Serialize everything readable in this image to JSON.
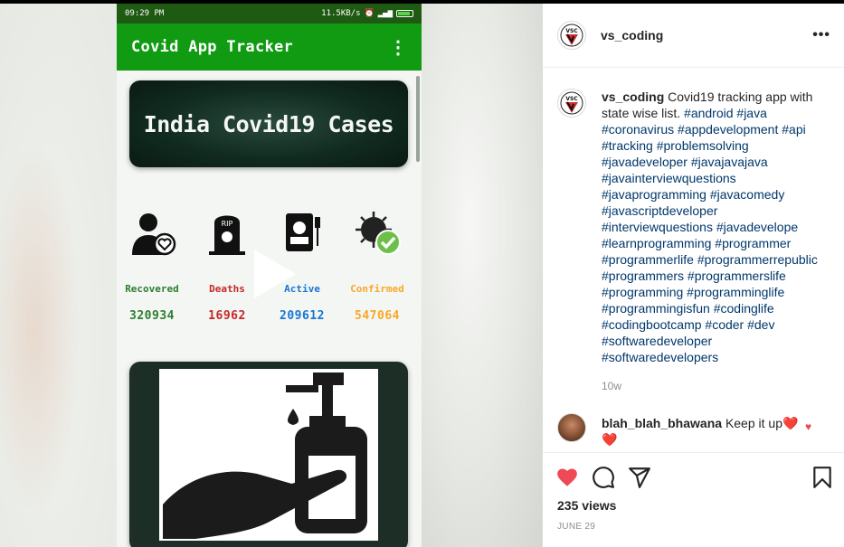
{
  "phone": {
    "status_time": "09:29 PM",
    "status_speed": "11.5KB/s",
    "app_title": "Covid App Tracker",
    "banner_title": "India Covid19 Cases",
    "stats": [
      {
        "label": "Recovered",
        "value": "320934",
        "color": "#2e7d32"
      },
      {
        "label": "Deaths",
        "value": "16962",
        "color": "#c62828"
      },
      {
        "label": "Active",
        "value": "209612",
        "color": "#1976d2"
      },
      {
        "label": "Confirmed",
        "value": "547064",
        "color": "#f9a825"
      }
    ],
    "banner_rip": "RIP"
  },
  "post": {
    "username": "vs_coding",
    "avatar_text": "VSC",
    "caption_text": "Covid19 tracking app with state wise list.",
    "hashtags": "#android #java #coronavirus #appdevelopment #api #tracking #problemsolving #javadeveloper #javajavajava #javainterviewquestions #javaprogramming #javacomedy #javascriptdeveloper #interviewquestions #javadevelope #learnprogramming #programmer #programmerlife #programmerrepublic #programmers #programmerslife #programming #programminglife #programmingisfun #codinglife #codingbootcamp #coder #dev #softwaredeveloper #softwaredevelopers",
    "caption_age": "10w",
    "comment": {
      "username": "blah_blah_bhawana",
      "text": "Keep it up",
      "emoji": "❤️"
    },
    "views": "235 views",
    "date": "JUNE 29"
  },
  "colors": {
    "like": "#ed4956",
    "link": "#00376b",
    "appbar": "#109b12"
  }
}
